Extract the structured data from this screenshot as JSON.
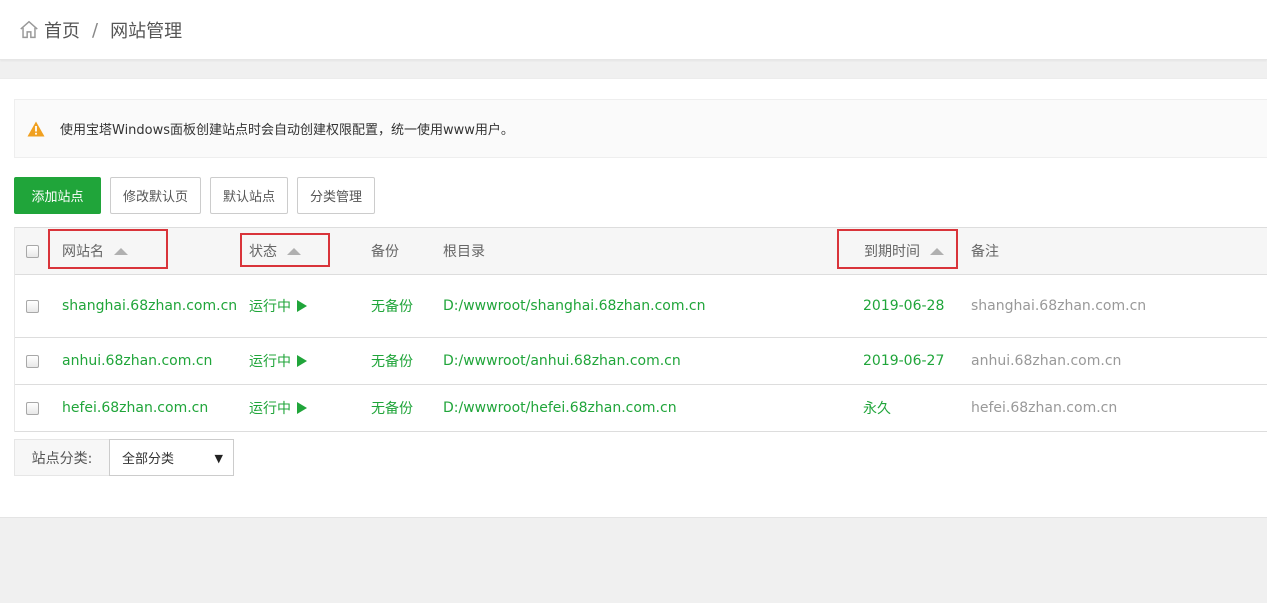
{
  "breadcrumb": {
    "home": "首页",
    "separator": "/",
    "current": "网站管理"
  },
  "alert": {
    "text": "使用宝塔Windows面板创建站点时会自动创建权限配置，统一使用www用户。"
  },
  "toolbar": {
    "add_site": "添加站点",
    "edit_default_page": "修改默认页",
    "default_site": "默认站点",
    "category_manage": "分类管理"
  },
  "table": {
    "headers": {
      "name": "网站名",
      "status": "状态",
      "backup": "备份",
      "root": "根目录",
      "expire": "到期时间",
      "remark": "备注"
    },
    "rows": [
      {
        "name": "shanghai.68zhan.com.cn",
        "status": "运行中",
        "backup": "无备份",
        "root": "D:/wwwroot/shanghai.68zhan.com.cn",
        "expire": "2019-06-28",
        "remark": "shanghai.68zhan.com.cn"
      },
      {
        "name": "anhui.68zhan.com.cn",
        "status": "运行中",
        "backup": "无备份",
        "root": "D:/wwwroot/anhui.68zhan.com.cn",
        "expire": "2019-06-27",
        "remark": "anhui.68zhan.com.cn"
      },
      {
        "name": "hefei.68zhan.com.cn",
        "status": "运行中",
        "backup": "无备份",
        "root": "D:/wwwroot/hefei.68zhan.com.cn",
        "expire": "永久",
        "remark": "hefei.68zhan.com.cn"
      }
    ]
  },
  "category": {
    "label": "站点分类:",
    "selected": "全部分类"
  },
  "colors": {
    "accent": "#20a53a",
    "highlight_box": "#d9343a",
    "warning": "#f0a020"
  }
}
